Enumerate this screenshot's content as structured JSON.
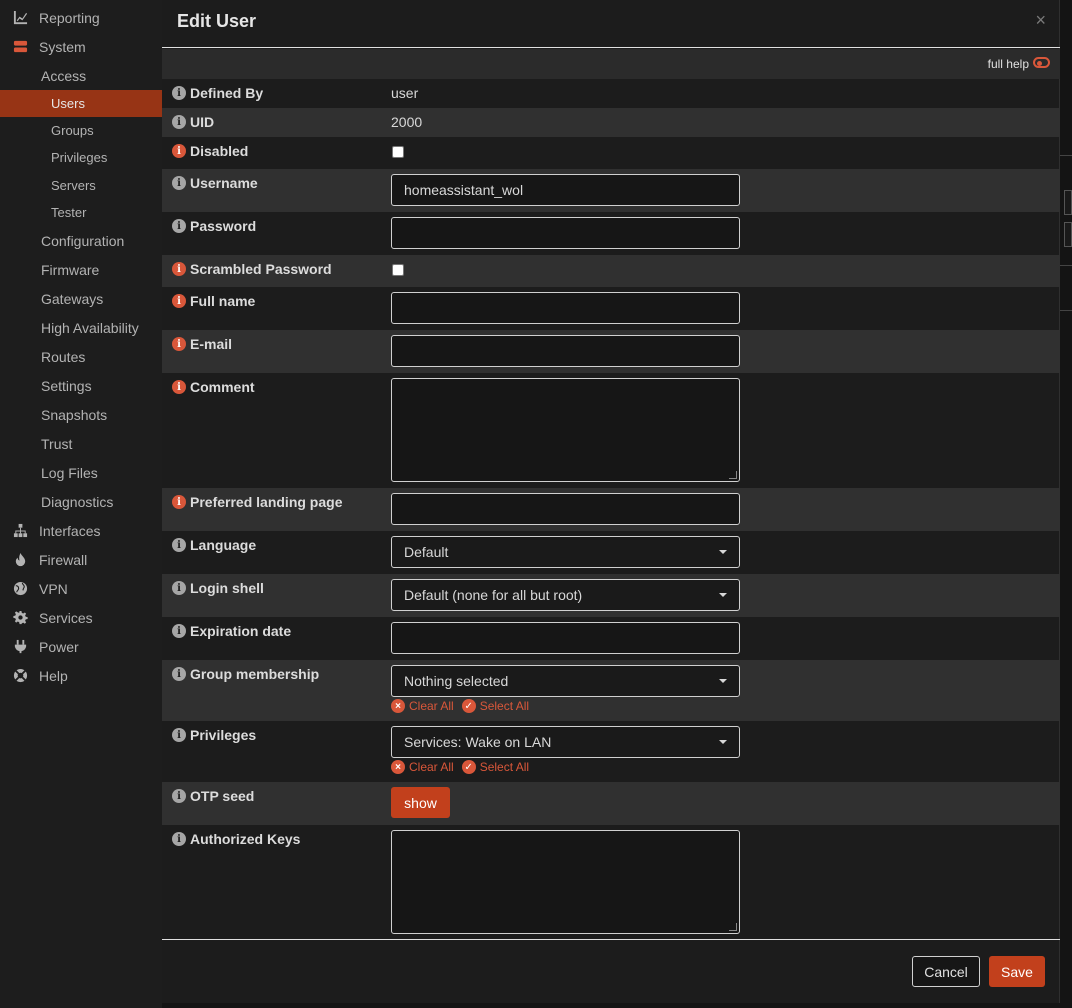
{
  "sidebar": {
    "top_items": [
      {
        "label": "Reporting",
        "icon": "chart-icon"
      },
      {
        "label": "System",
        "icon": "server-icon"
      }
    ],
    "system_items": [
      "Access",
      "Configuration",
      "Firmware",
      "Gateways",
      "High Availability",
      "Routes",
      "Settings",
      "Snapshots",
      "Trust",
      "Log Files",
      "Diagnostics"
    ],
    "access_items": [
      "Users",
      "Groups",
      "Privileges",
      "Servers",
      "Tester"
    ],
    "active_item": "Users",
    "bottom_items": [
      {
        "label": "Interfaces",
        "icon": "network-icon"
      },
      {
        "label": "Firewall",
        "icon": "fire-icon"
      },
      {
        "label": "VPN",
        "icon": "globe-icon"
      },
      {
        "label": "Services",
        "icon": "gear-icon"
      },
      {
        "label": "Power",
        "icon": "plug-icon"
      },
      {
        "label": "Help",
        "icon": "lifebuoy-icon"
      }
    ]
  },
  "modal": {
    "title": "Edit User",
    "close_symbol": "×",
    "full_help_label": "full help",
    "fields": {
      "defined_by": {
        "label": "Defined By",
        "value": "user"
      },
      "uid": {
        "label": "UID",
        "value": "2000"
      },
      "disabled": {
        "label": "Disabled",
        "checked": false
      },
      "username": {
        "label": "Username",
        "value": "homeassistant_wol"
      },
      "password": {
        "label": "Password",
        "value": ""
      },
      "scrambled_password": {
        "label": "Scrambled Password",
        "checked": false
      },
      "full_name": {
        "label": "Full name",
        "value": ""
      },
      "email": {
        "label": "E-mail",
        "value": ""
      },
      "comment": {
        "label": "Comment",
        "value": ""
      },
      "landing_page": {
        "label": "Preferred landing page",
        "value": ""
      },
      "language": {
        "label": "Language",
        "value": "Default"
      },
      "login_shell": {
        "label": "Login shell",
        "value": "Default (none for all but root)"
      },
      "expiration_date": {
        "label": "Expiration date",
        "value": ""
      },
      "group_membership": {
        "label": "Group membership",
        "value": "Nothing selected"
      },
      "privileges": {
        "label": "Privileges",
        "value": "Services: Wake on LAN"
      },
      "otp_seed": {
        "label": "OTP seed",
        "button": "show"
      },
      "authorized_keys": {
        "label": "Authorized Keys",
        "value": ""
      }
    },
    "clear_all": "Clear All",
    "select_all": "Select All",
    "cancel": "Cancel",
    "save": "Save"
  },
  "colors": {
    "accent": "#c2401c",
    "active_nav": "#973415",
    "info_required": "#d9573a",
    "info_optional": "#a6a6a6"
  }
}
